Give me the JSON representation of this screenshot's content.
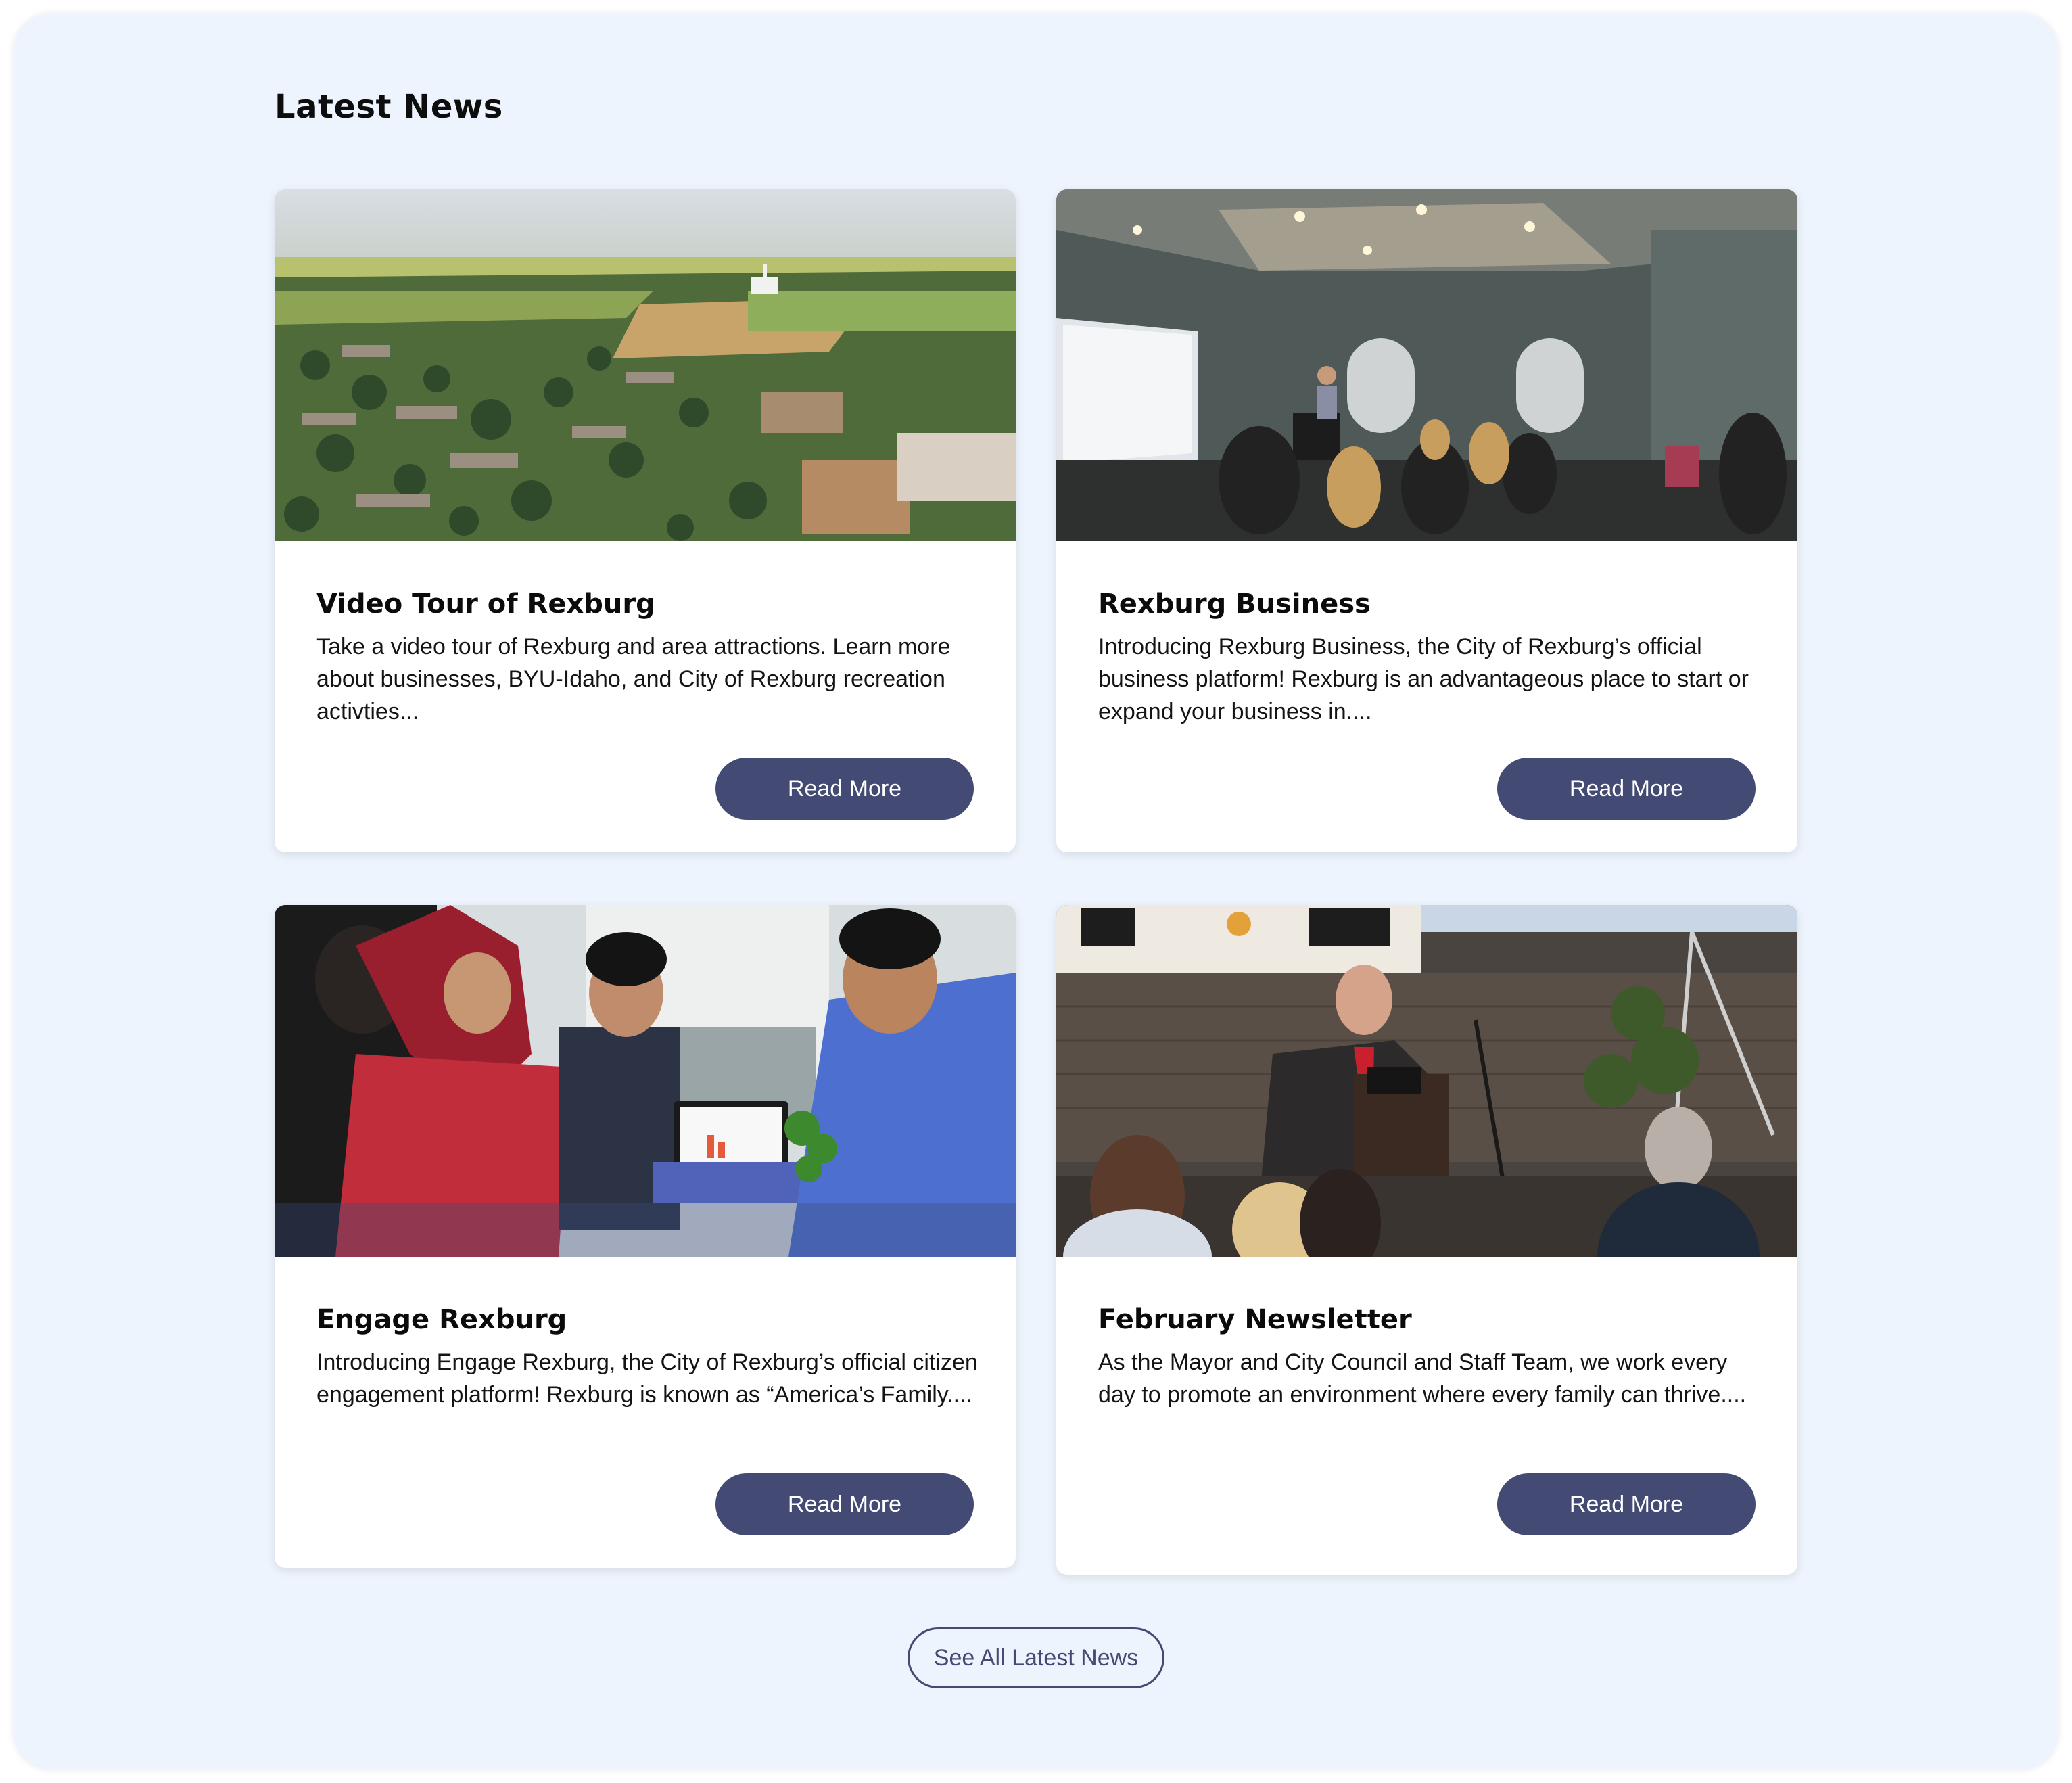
{
  "section": {
    "title": "Latest News",
    "see_all_label": "See All Latest News"
  },
  "cards": [
    {
      "image": "aerial-view-of-rexburg-photo",
      "title": "Video Tour of Rexburg",
      "excerpt": "Take a video tour of Rexburg and area attractions. Learn more about businesses, BYU-Idaho, and City of Rexburg recreation activties...",
      "button": "Read More"
    },
    {
      "image": "business-presentation-meeting-photo",
      "title": "Rexburg Business",
      "excerpt": "Introducing Rexburg Business, the City of Rexburg’s official business platform! Rexburg is an advantageous place to start or expand your business in....",
      "button": "Read More"
    },
    {
      "image": "group-using-laptop-photo",
      "title": "Engage Rexburg",
      "excerpt": "Introducing Engage Rexburg, the City of Rexburg’s official citizen engagement platform! Rexburg is known as “America’s Family....",
      "button": "Read More"
    },
    {
      "image": "mayor-speaking-at-podium-photo",
      "title": "February Newsletter",
      "excerpt": "As the Mayor and City Council and Staff Team, we work every day to promote an environment where every family can thrive....",
      "button": "Read More"
    }
  ],
  "colors": {
    "background": "#eef4fd",
    "button": "#434a73",
    "card": "#ffffff"
  }
}
